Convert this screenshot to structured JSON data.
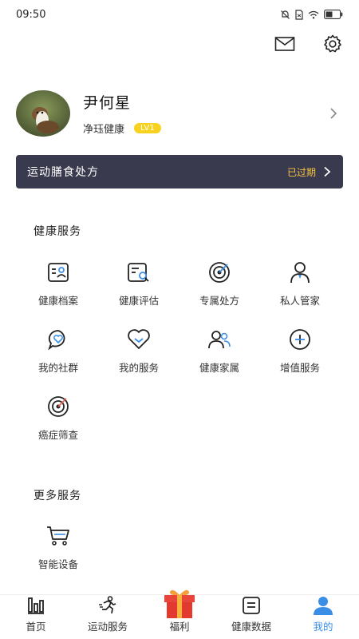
{
  "status_bar": {
    "time": "09:50"
  },
  "profile": {
    "name": "尹何星",
    "org": "净珏健康",
    "level": "LV1"
  },
  "plan": {
    "title": "运动膳食处方",
    "status": "已过期"
  },
  "health_services": {
    "title": "健康服务",
    "items": [
      {
        "label": "健康档案",
        "icon": "health-record-icon"
      },
      {
        "label": "健康评估",
        "icon": "health-assessment-icon"
      },
      {
        "label": "专属处方",
        "icon": "exclusive-prescription-icon"
      },
      {
        "label": "私人管家",
        "icon": "personal-butler-icon"
      },
      {
        "label": "我的社群",
        "icon": "community-icon"
      },
      {
        "label": "我的服务",
        "icon": "my-service-icon"
      },
      {
        "label": "健康家属",
        "icon": "family-icon"
      },
      {
        "label": "增值服务",
        "icon": "add-service-icon"
      },
      {
        "label": "癌症筛查",
        "icon": "cancer-screening-icon"
      }
    ]
  },
  "more_services": {
    "title": "更多服务",
    "items": [
      {
        "label": "智能设备",
        "icon": "cart-icon"
      }
    ]
  },
  "tab_bar": {
    "tabs": [
      {
        "label": "首页",
        "icon": "home-icon"
      },
      {
        "label": "运动服务",
        "icon": "running-icon"
      },
      {
        "label": "福利",
        "icon": "gift-icon"
      },
      {
        "label": "健康数据",
        "icon": "data-icon"
      },
      {
        "label": "我的",
        "icon": "user-icon"
      }
    ],
    "active": "我的"
  },
  "colors": {
    "plan_bar": "#3a3a4f",
    "accent": "#3a8ee6",
    "badge": "#f7d21e",
    "expired": "#f5c542"
  }
}
